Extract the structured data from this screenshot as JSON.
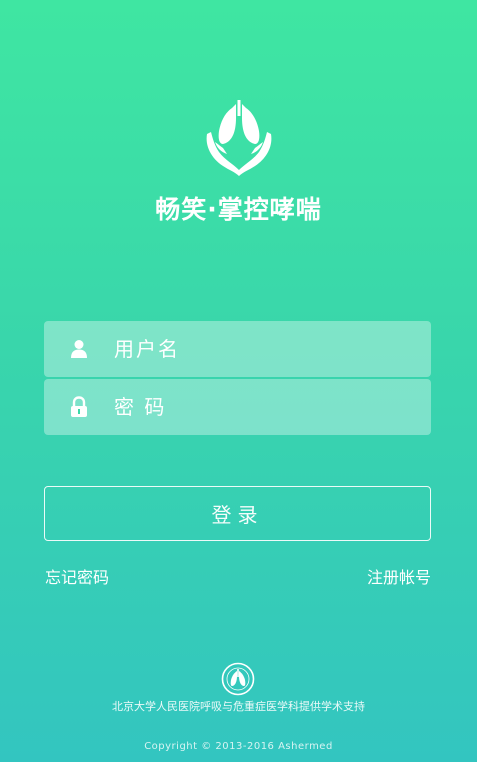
{
  "app": {
    "slogan": "畅笑·掌控哮喘",
    "logo_icon": "lungs-hands-icon"
  },
  "form": {
    "username_placeholder": "用户名",
    "password_placeholder": "密 码",
    "username_icon": "user-icon",
    "password_icon": "lock-icon",
    "login_label": "登录"
  },
  "links": {
    "forgot_password": "忘记密码",
    "register": "注册帐号"
  },
  "footer": {
    "badge_icon": "hospital-seal-icon",
    "support_text": "北京大学人民医院呼吸与危重症医学科提供学术支持",
    "copyright": "Copyright © 2013-2016 Ashermed"
  },
  "colors": {
    "gradient_top": "#3fe6a2",
    "gradient_bottom": "#33c5c0"
  }
}
